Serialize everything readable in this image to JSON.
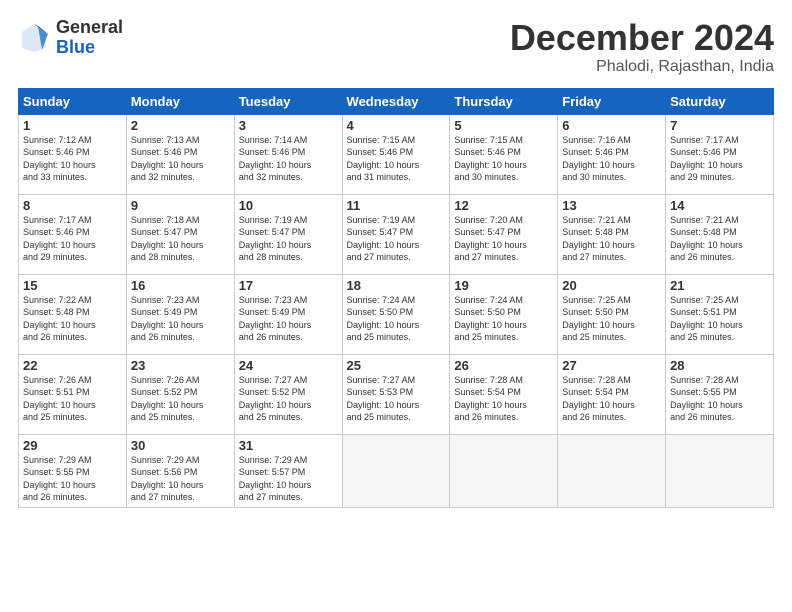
{
  "logo": {
    "general": "General",
    "blue": "Blue"
  },
  "title": "December 2024",
  "location": "Phalodi, Rajasthan, India",
  "weekdays": [
    "Sunday",
    "Monday",
    "Tuesday",
    "Wednesday",
    "Thursday",
    "Friday",
    "Saturday"
  ],
  "weeks": [
    [
      {
        "day": "1",
        "info": "Sunrise: 7:12 AM\nSunset: 5:46 PM\nDaylight: 10 hours\nand 33 minutes."
      },
      {
        "day": "2",
        "info": "Sunrise: 7:13 AM\nSunset: 5:46 PM\nDaylight: 10 hours\nand 32 minutes."
      },
      {
        "day": "3",
        "info": "Sunrise: 7:14 AM\nSunset: 5:46 PM\nDaylight: 10 hours\nand 32 minutes."
      },
      {
        "day": "4",
        "info": "Sunrise: 7:15 AM\nSunset: 5:46 PM\nDaylight: 10 hours\nand 31 minutes."
      },
      {
        "day": "5",
        "info": "Sunrise: 7:15 AM\nSunset: 5:46 PM\nDaylight: 10 hours\nand 30 minutes."
      },
      {
        "day": "6",
        "info": "Sunrise: 7:16 AM\nSunset: 5:46 PM\nDaylight: 10 hours\nand 30 minutes."
      },
      {
        "day": "7",
        "info": "Sunrise: 7:17 AM\nSunset: 5:46 PM\nDaylight: 10 hours\nand 29 minutes."
      }
    ],
    [
      {
        "day": "8",
        "info": "Sunrise: 7:17 AM\nSunset: 5:46 PM\nDaylight: 10 hours\nand 29 minutes."
      },
      {
        "day": "9",
        "info": "Sunrise: 7:18 AM\nSunset: 5:47 PM\nDaylight: 10 hours\nand 28 minutes."
      },
      {
        "day": "10",
        "info": "Sunrise: 7:19 AM\nSunset: 5:47 PM\nDaylight: 10 hours\nand 28 minutes."
      },
      {
        "day": "11",
        "info": "Sunrise: 7:19 AM\nSunset: 5:47 PM\nDaylight: 10 hours\nand 27 minutes."
      },
      {
        "day": "12",
        "info": "Sunrise: 7:20 AM\nSunset: 5:47 PM\nDaylight: 10 hours\nand 27 minutes."
      },
      {
        "day": "13",
        "info": "Sunrise: 7:21 AM\nSunset: 5:48 PM\nDaylight: 10 hours\nand 27 minutes."
      },
      {
        "day": "14",
        "info": "Sunrise: 7:21 AM\nSunset: 5:48 PM\nDaylight: 10 hours\nand 26 minutes."
      }
    ],
    [
      {
        "day": "15",
        "info": "Sunrise: 7:22 AM\nSunset: 5:48 PM\nDaylight: 10 hours\nand 26 minutes."
      },
      {
        "day": "16",
        "info": "Sunrise: 7:23 AM\nSunset: 5:49 PM\nDaylight: 10 hours\nand 26 minutes."
      },
      {
        "day": "17",
        "info": "Sunrise: 7:23 AM\nSunset: 5:49 PM\nDaylight: 10 hours\nand 26 minutes."
      },
      {
        "day": "18",
        "info": "Sunrise: 7:24 AM\nSunset: 5:50 PM\nDaylight: 10 hours\nand 25 minutes."
      },
      {
        "day": "19",
        "info": "Sunrise: 7:24 AM\nSunset: 5:50 PM\nDaylight: 10 hours\nand 25 minutes."
      },
      {
        "day": "20",
        "info": "Sunrise: 7:25 AM\nSunset: 5:50 PM\nDaylight: 10 hours\nand 25 minutes."
      },
      {
        "day": "21",
        "info": "Sunrise: 7:25 AM\nSunset: 5:51 PM\nDaylight: 10 hours\nand 25 minutes."
      }
    ],
    [
      {
        "day": "22",
        "info": "Sunrise: 7:26 AM\nSunset: 5:51 PM\nDaylight: 10 hours\nand 25 minutes."
      },
      {
        "day": "23",
        "info": "Sunrise: 7:26 AM\nSunset: 5:52 PM\nDaylight: 10 hours\nand 25 minutes."
      },
      {
        "day": "24",
        "info": "Sunrise: 7:27 AM\nSunset: 5:52 PM\nDaylight: 10 hours\nand 25 minutes."
      },
      {
        "day": "25",
        "info": "Sunrise: 7:27 AM\nSunset: 5:53 PM\nDaylight: 10 hours\nand 25 minutes."
      },
      {
        "day": "26",
        "info": "Sunrise: 7:28 AM\nSunset: 5:54 PM\nDaylight: 10 hours\nand 26 minutes."
      },
      {
        "day": "27",
        "info": "Sunrise: 7:28 AM\nSunset: 5:54 PM\nDaylight: 10 hours\nand 26 minutes."
      },
      {
        "day": "28",
        "info": "Sunrise: 7:28 AM\nSunset: 5:55 PM\nDaylight: 10 hours\nand 26 minutes."
      }
    ],
    [
      {
        "day": "29",
        "info": "Sunrise: 7:29 AM\nSunset: 5:55 PM\nDaylight: 10 hours\nand 26 minutes."
      },
      {
        "day": "30",
        "info": "Sunrise: 7:29 AM\nSunset: 5:56 PM\nDaylight: 10 hours\nand 27 minutes."
      },
      {
        "day": "31",
        "info": "Sunrise: 7:29 AM\nSunset: 5:57 PM\nDaylight: 10 hours\nand 27 minutes."
      },
      null,
      null,
      null,
      null
    ]
  ]
}
